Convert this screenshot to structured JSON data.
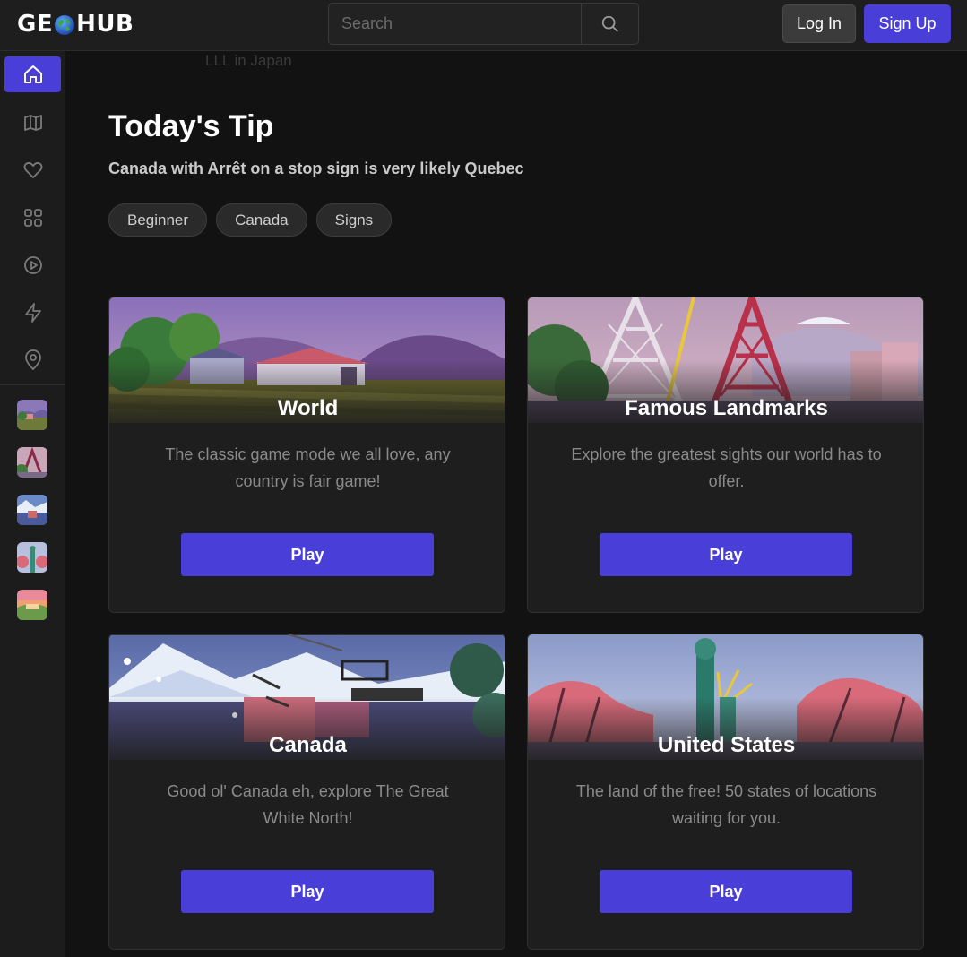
{
  "header": {
    "logo_left": "GE",
    "logo_right": "HUB",
    "search_placeholder": "Search",
    "login_label": "Log In",
    "signup_label": "Sign Up"
  },
  "sidebar": {
    "items": [
      "home-icon",
      "map-icon",
      "heart-icon",
      "grid-icon",
      "play-circle-icon",
      "lightning-icon",
      "location-pin-icon"
    ],
    "active": "home-icon"
  },
  "ghost_text": "LLL in Japan",
  "tip": {
    "title": "Today's Tip",
    "text": "Canada with Arrêt on a stop sign is very likely Quebec",
    "tags": [
      "Beginner",
      "Canada",
      "Signs"
    ]
  },
  "cards": [
    {
      "title": "World",
      "description": "The classic game mode we all love, any country is fair game!",
      "button": "Play"
    },
    {
      "title": "Famous Landmarks",
      "description": "Explore the greatest sights our world has to offer.",
      "button": "Play"
    },
    {
      "title": "Canada",
      "description": "Good ol' Canada eh, explore The Great White North!",
      "button": "Play"
    },
    {
      "title": "United States",
      "description": "The land of the free! 50 states of locations waiting for you.",
      "button": "Play"
    }
  ],
  "colors": {
    "accent": "#4a3ed8",
    "background": "#121212",
    "surface": "#1e1e1e"
  }
}
